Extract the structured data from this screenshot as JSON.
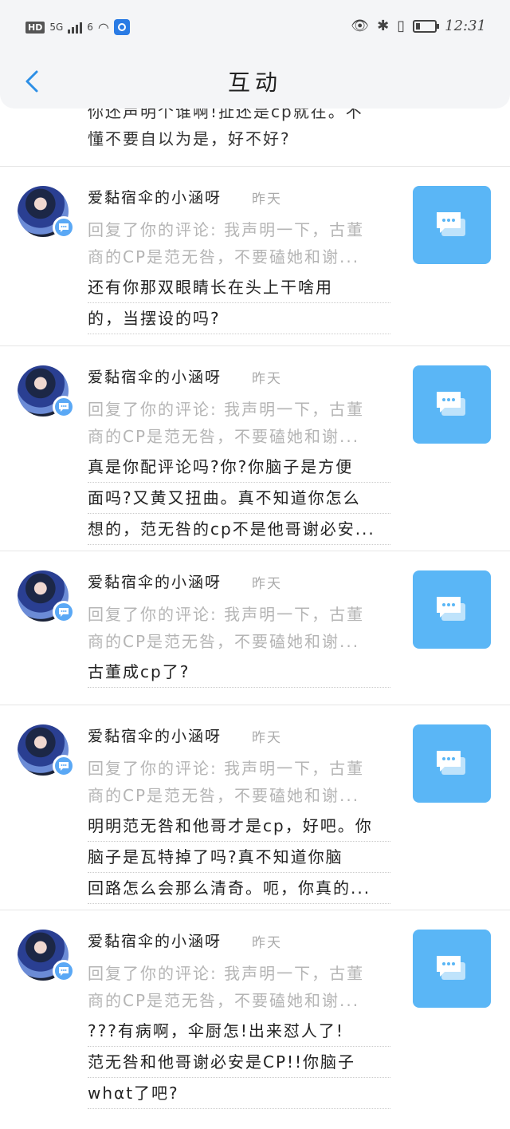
{
  "status_bar": {
    "network_badge": "HD",
    "signal_label": "5G",
    "wifi_label": "6",
    "time": "12:31"
  },
  "header": {
    "title": "互动"
  },
  "fragment": {
    "line1": "你还声明个谁啊!扯还是cp就在。不",
    "line2": "懂不要自以为是，好不好?"
  },
  "items": [
    {
      "username": "爱黏宿伞的小涵呀",
      "time": "昨天",
      "quote_lines": [
        "回复了你的评论: 我声明一下，古董",
        "商的CP是范无咎，不要磕她和谢..."
      ],
      "comment_lines": [
        "还有你那双眼睛长在头上干啥用",
        "的，当摆设的吗?"
      ]
    },
    {
      "username": "爱黏宿伞的小涵呀",
      "time": "昨天",
      "quote_lines": [
        "回复了你的评论: 我声明一下，古董",
        "商的CP是范无咎，不要磕她和谢..."
      ],
      "comment_lines": [
        "真是你配评论吗?你?你脑子是方便",
        "面吗?又黄又扭曲。真不知道你怎么",
        "想的，范无咎的cp不是他哥谢必安..."
      ]
    },
    {
      "username": "爱黏宿伞的小涵呀",
      "time": "昨天",
      "quote_lines": [
        "回复了你的评论: 我声明一下，古董",
        "商的CP是范无咎，不要磕她和谢..."
      ],
      "comment_lines": [
        "古董成cp了?"
      ]
    },
    {
      "username": "爱黏宿伞的小涵呀",
      "time": "昨天",
      "quote_lines": [
        "回复了你的评论: 我声明一下，古董",
        "商的CP是范无咎，不要磕她和谢..."
      ],
      "comment_lines": [
        "明明范无咎和他哥才是cp，好吧。你",
        "脑子是瓦特掉了吗?真不知道你脑",
        "回路怎么会那么清奇。呃，你真的..."
      ]
    },
    {
      "username": "爱黏宿伞的小涵呀",
      "time": "昨天",
      "quote_lines": [
        "回复了你的评论: 我声明一下，古董",
        "商的CP是范无咎，不要磕她和谢..."
      ],
      "comment_lines": [
        "???有病啊，伞厨怎!出来怼人了!",
        "范无咎和他哥谢必安是CP!!你脑子",
        "whαt了吧?"
      ]
    }
  ],
  "icons": {
    "back": "chevron-left-icon",
    "reply": "chat-bubbles-icon",
    "badge": "comment-badge-icon"
  },
  "colors": {
    "accent": "#5ab6f6",
    "back_arrow": "#2d8fe6",
    "quote_text": "#b5b5b5"
  }
}
